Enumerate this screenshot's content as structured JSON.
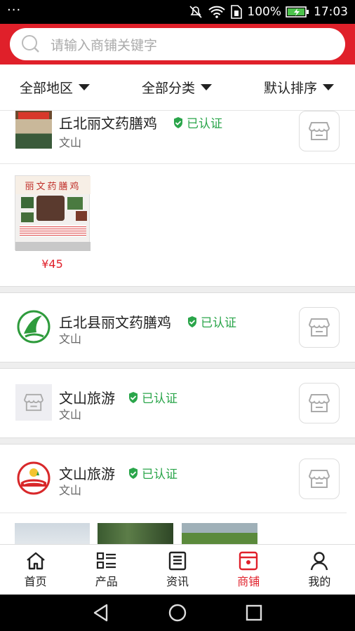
{
  "status_bar": {
    "dots": "···",
    "battery": "100%",
    "time": "17:03"
  },
  "search": {
    "placeholder": "请输入商铺关键字"
  },
  "filters": [
    {
      "label": "全部地区"
    },
    {
      "label": "全部分类"
    },
    {
      "label": "默认排序"
    }
  ],
  "shops": [
    {
      "name": "丘北丽文药膳鸡",
      "verified": "已认证",
      "region": "文山",
      "products": [
        {
          "title_on_image": "丽文药膳鸡",
          "price": "¥45"
        }
      ]
    },
    {
      "name": "丘北县丽文药膳鸡",
      "verified": "已认证",
      "region": "文山"
    },
    {
      "name": "文山旅游",
      "verified": "已认证",
      "region": "文山"
    },
    {
      "name": "文山旅游",
      "verified": "已认证",
      "region": "文山"
    }
  ],
  "tabs": [
    {
      "label": "首页",
      "icon": "home-icon"
    },
    {
      "label": "产品",
      "icon": "list-icon"
    },
    {
      "label": "资讯",
      "icon": "news-icon"
    },
    {
      "label": "商铺",
      "icon": "shop-icon",
      "active": true
    },
    {
      "label": "我的",
      "icon": "user-icon"
    }
  ],
  "colors": {
    "brand": "#e0202a",
    "verified": "#2aa54a"
  }
}
